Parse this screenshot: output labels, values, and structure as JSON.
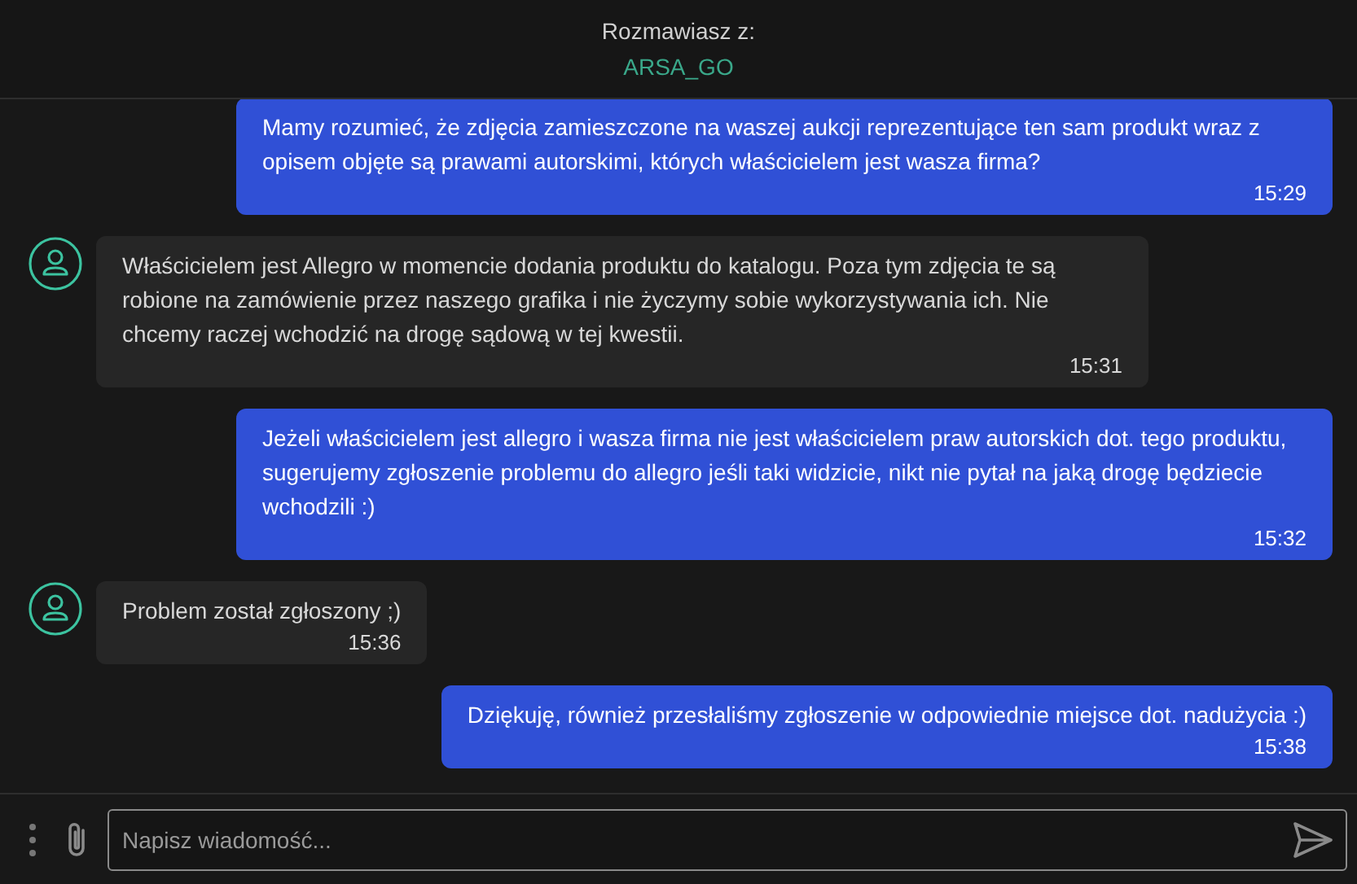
{
  "header": {
    "label": "Rozmawiasz z:",
    "contact": "ARSA_GO"
  },
  "messages": [
    {
      "kind": "outgoing",
      "text": "Mamy rozumieć, że zdjęcia zamieszczone na waszej aukcji reprezentujące ten sam produkt wraz z opisem objęte są prawami autorskimi, których właścicielem jest wasza firma?",
      "time": "15:29"
    },
    {
      "kind": "incoming",
      "text": "Właścicielem jest Allegro w momencie dodania produktu do katalogu. Poza tym zdjęcia te są robione na zamówienie przez naszego grafika i nie życzymy sobie wykorzystywania ich. Nie chcemy raczej wchodzić na drogę sądową w tej kwestii.",
      "time": "15:31"
    },
    {
      "kind": "outgoing",
      "text": "Jeżeli właścicielem jest allegro i wasza firma nie jest właścicielem praw autorskich dot. tego produktu, sugerujemy zgłoszenie problemu do allegro jeśli taki widzicie, nikt nie pytał na jaką drogę będziecie wchodzili :)",
      "time": "15:32"
    },
    {
      "kind": "incoming",
      "text": "Problem został zgłoszony ;)",
      "time": "15:36"
    },
    {
      "kind": "outgoing",
      "text": "Dziękuję, również przesłaliśmy zgłoszenie w odpowiednie miejsce dot. nadużycia :)",
      "time": "15:38"
    }
  ],
  "composer": {
    "placeholder": "Napisz wiadomość..."
  }
}
